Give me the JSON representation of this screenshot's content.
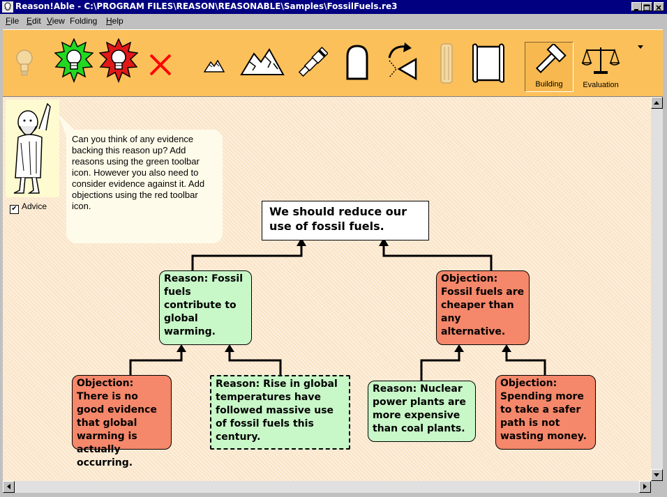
{
  "window": {
    "title": "Reason!Able - C:\\PROGRAM FILES\\REASON\\REASONABLE\\Samples\\FossilFuels.re3",
    "controls": [
      "_",
      "□",
      "×"
    ]
  },
  "menu": {
    "items": [
      {
        "label": "File",
        "mnemonic": "F",
        "rest": "ile"
      },
      {
        "label": "Edit",
        "mnemonic": "E",
        "rest": "dit"
      },
      {
        "label": "View",
        "mnemonic": "V",
        "rest": "iew"
      },
      {
        "label": "Folding",
        "mnemonic": "",
        "rest": "Folding"
      },
      {
        "label": "Help",
        "mnemonic": "H",
        "rest": "elp"
      }
    ]
  },
  "toolbar": {
    "background": "#fcc05a",
    "buttons": [
      {
        "icon": "faded-lightbulb-icon"
      },
      {
        "icon": "green-lightbulb-icon"
      },
      {
        "icon": "red-lightbulb-icon"
      },
      {
        "icon": "red-x-delete-icon"
      },
      {
        "icon": "small-mountains-icon"
      },
      {
        "icon": "large-mountains-icon"
      },
      {
        "icon": "telescope-icon"
      },
      {
        "icon": "tombstone-icon"
      },
      {
        "icon": "rotate-arrow-icon"
      },
      {
        "icon": "pillar-icon"
      },
      {
        "icon": "scroll-icon"
      }
    ],
    "modes": {
      "building_label": "Building",
      "evaluation_label": "Evaluation"
    }
  },
  "advice": {
    "checkbox_label": "Advice",
    "checked": true,
    "bubble_text": "Can you think of any evidence backing this reason up? Add reasons using the green toolbar icon.  However you also need to consider evidence against it. Add objections using the red toolbar icon."
  },
  "map": {
    "claim": "We should reduce our use of fossil fuels.",
    "reason1": "Reason: Fossil fuels contribute to global warming.",
    "objection1": "Objection: Fossil fuels are cheaper than any alternative.",
    "objection2": "Objection: There is no good evidence that global warming is actually occurring.",
    "reason2": "Reason: Rise in global temperatures have followed massive use of fossil fuels this century.",
    "reason3": "Reason: Nuclear power plants are more expensive than coal plants.",
    "objection3": "Objection: Spending more to take a safer path is not wasting money."
  },
  "colors": {
    "reason": "#c8f7c8",
    "objection": "#f5876a",
    "claim": "#ffffff",
    "titlebar": "#000080"
  }
}
